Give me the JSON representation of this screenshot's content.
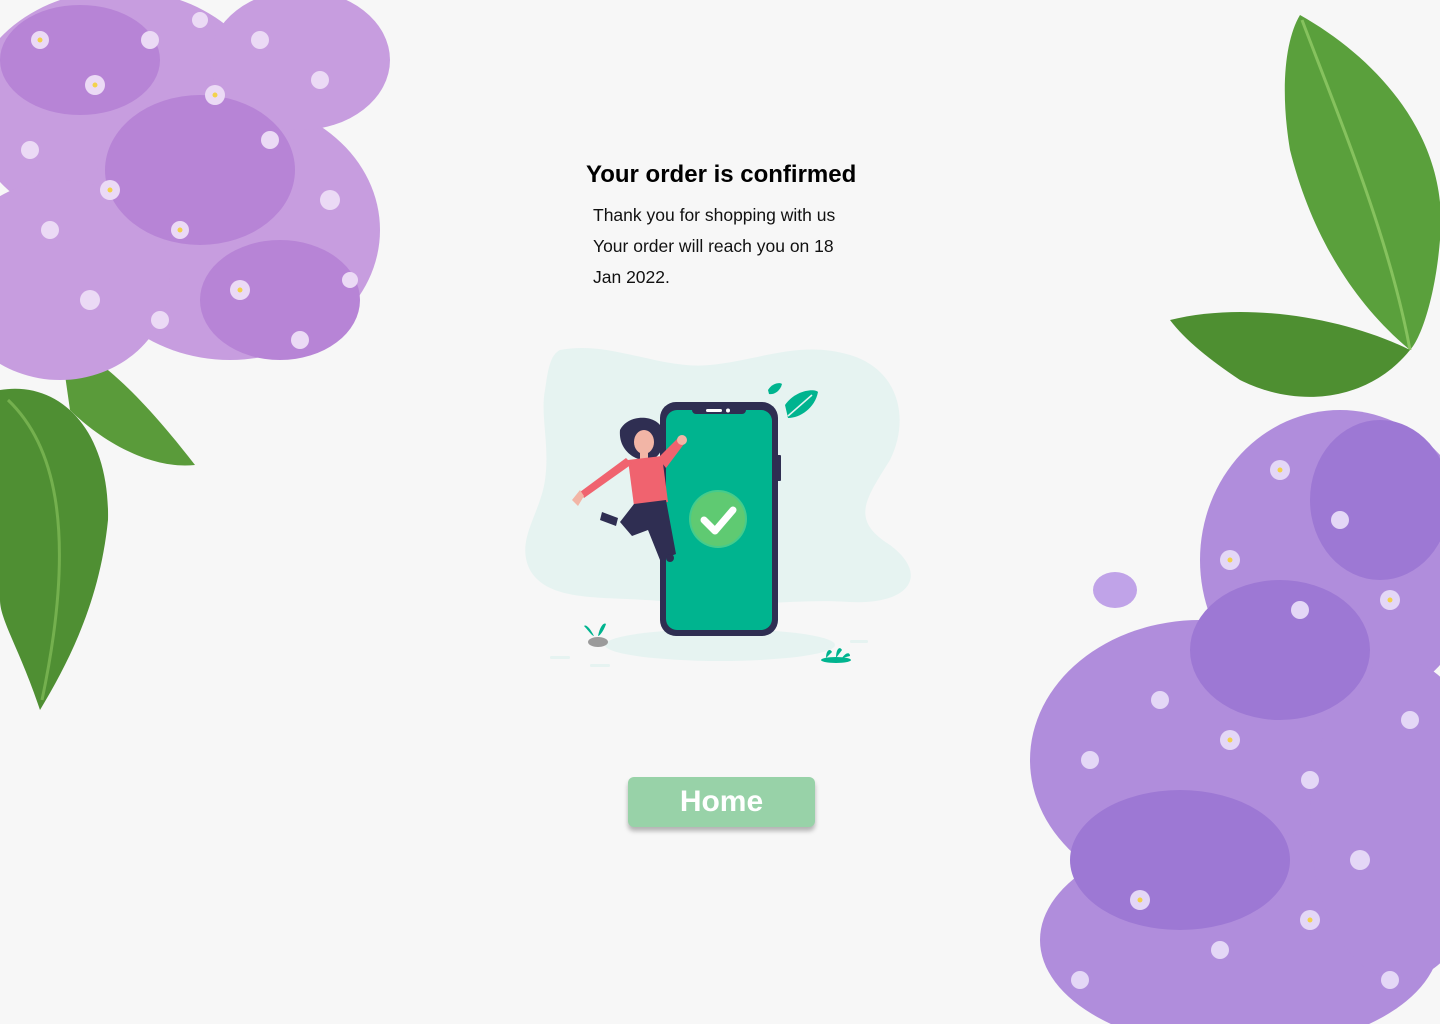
{
  "confirmation": {
    "title": "Your order is confirmed",
    "thank_you": "Thank you for shopping with us",
    "delivery_line": "Your order will reach you on 18 Jan 2022."
  },
  "illustration": {
    "icon": "check-icon",
    "accent": "#00b48f",
    "blob": "#e6f3f1"
  },
  "actions": {
    "home_label": "Home",
    "home_color": "#98d2a8"
  },
  "decor": {
    "flower_color": "#b98bd8",
    "leaf_color": "#5c9e3c"
  }
}
